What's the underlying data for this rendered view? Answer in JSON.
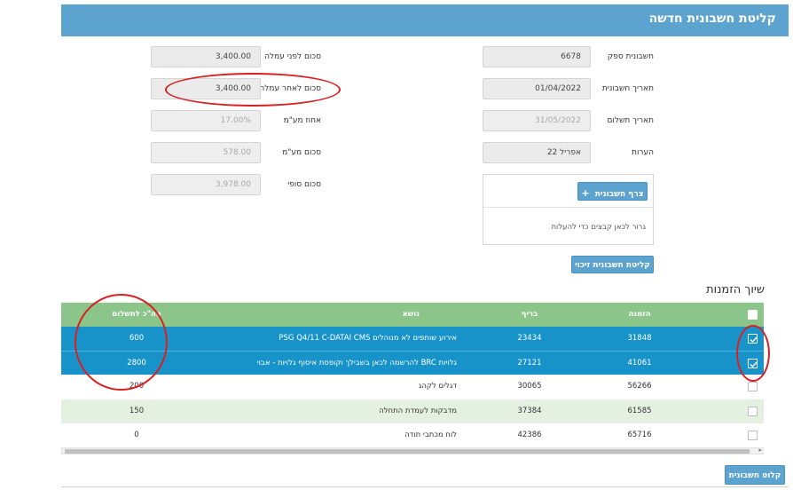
{
  "header": {
    "title": "קליטת חשבונית חדשה"
  },
  "form_right": [
    {
      "label": "חשבונית ספק",
      "value": "6678"
    },
    {
      "label": "תאריך חשבונית",
      "value": "01/04/2022"
    },
    {
      "label": "תאריך תשלום",
      "value": "31/05/2022"
    },
    {
      "label": "הערות",
      "value": "אפריל 22"
    }
  ],
  "form_left": [
    {
      "label": "סכום לפני עמלה",
      "value": "3,400.00"
    },
    {
      "label": "סכום לאחר עמלה",
      "value": "3,400.00"
    },
    {
      "label": "אחוז מע\"מ",
      "value": "17.00%"
    },
    {
      "label": "סכום מע\"מ",
      "value": "578.00"
    },
    {
      "label": "סכום סופי",
      "value": "3,978.00"
    }
  ],
  "upload": {
    "attach_button": "צרף חשבונית",
    "hint": "גרור לכאן קבצים כדי להעלות"
  },
  "credit_button": "קליטת חשבונית זיכוי",
  "orders_section": {
    "title": "שיוך הזמנות"
  },
  "table": {
    "columns": {
      "order": "הזמנה",
      "ref": "בריף",
      "subject": "נושא",
      "total": "סה\"כ לתשלום"
    },
    "rows": [
      {
        "order": "31848",
        "ref": "23434",
        "subject": "אירוע שותפים לא מנוהלים PSG Q4/11 C-DATAI CMS",
        "total": "600",
        "checked": true
      },
      {
        "order": "41061",
        "ref": "27121",
        "subject": "גלויות BRC להרשמה לכאן בשבילך וקופסת איסוף גלויות - אבוי",
        "total": "2800",
        "checked": true
      },
      {
        "order": "56266",
        "ref": "30065",
        "subject": "דגלים לקהג",
        "total": "200",
        "checked": false
      },
      {
        "order": "61585",
        "ref": "37384",
        "subject": "מדבקות לעמדת התחלה",
        "total": "150",
        "checked": false
      },
      {
        "order": "65716",
        "ref": "42386",
        "subject": "לוח מכתבי תודה",
        "total": "0",
        "checked": false
      }
    ]
  },
  "footer": {
    "close_button": "קלוט חשבונית"
  },
  "colors": {
    "header": "#5ca3cf",
    "table_head": "#8cc58a",
    "selected_row": "#1793c9",
    "alt_row": "#e4f1e1",
    "annotation": "#d92020"
  }
}
